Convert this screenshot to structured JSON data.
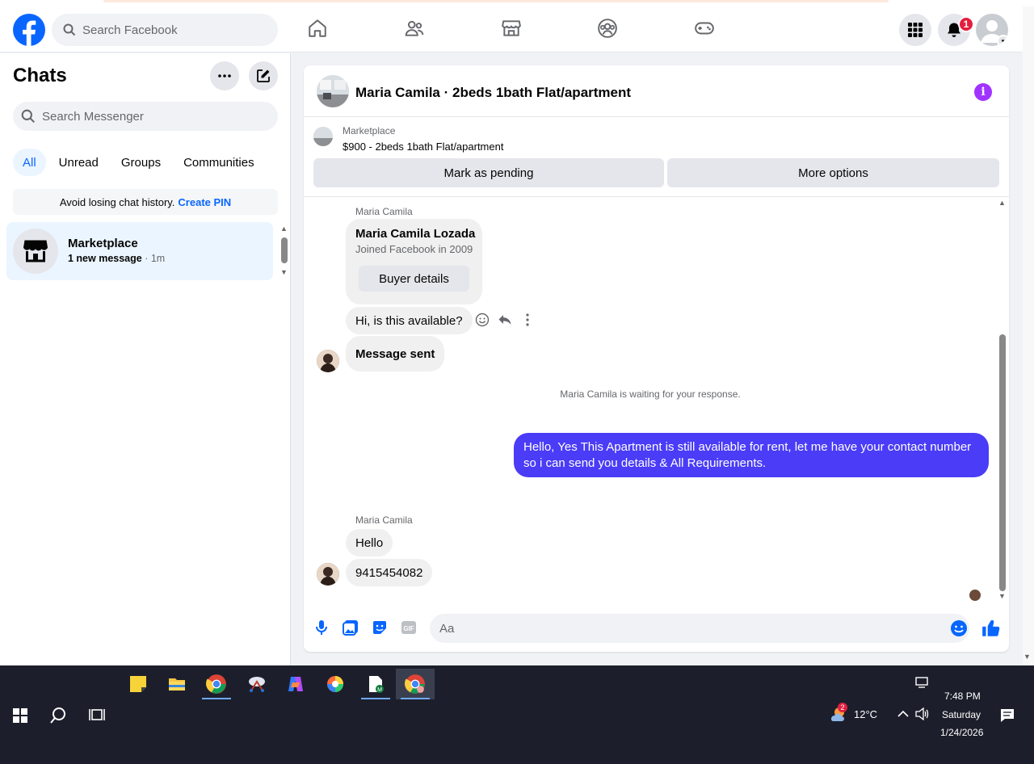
{
  "nav": {
    "search_placeholder": "Search Facebook",
    "notification_count": "1"
  },
  "sidebar": {
    "title": "Chats",
    "search_placeholder": "Search Messenger",
    "filters": [
      "All",
      "Unread",
      "Groups",
      "Communities"
    ],
    "pin_banner": {
      "text": "Avoid losing chat history.",
      "link": "Create PIN"
    },
    "chats": [
      {
        "name": "Marketplace",
        "preview": "1 new message",
        "time": "· 1m"
      }
    ]
  },
  "conversation": {
    "title": "Maria Camila · 2beds 1bath Flat/apartment",
    "marketplace_label": "Marketplace",
    "listing": "$900 - 2beds 1bath Flat/apartment",
    "actions": {
      "pending": "Mark as pending",
      "more": "More options"
    },
    "messages": {
      "sender1": "Maria Camila",
      "card_name": "Maria Camila Lozada",
      "card_joined": "Joined Facebook in 2009",
      "card_button": "Buyer details",
      "msg1": "Hi, is this available?",
      "msg2": "Message sent",
      "waiting": "Maria Camila is waiting for your response.",
      "outgoing": "Hello, Yes This Apartment is still available for rent, let me have your contact number so i can send you details & All Requirements.",
      "sender2": "Maria Camila",
      "msg3": "Hello",
      "msg4": "9415454082"
    },
    "composer_placeholder": "Aa"
  },
  "taskbar": {
    "weather_temp": "12°C",
    "weather_badge": "2",
    "time": "7:48 PM",
    "day": "Saturday",
    "date": "1/24/2026"
  },
  "colors": {
    "facebook_blue": "#0866ff",
    "outgoing_bubble": "#4a3cf7",
    "info_purple": "#a033ff",
    "badge_red": "#e41e3f"
  }
}
